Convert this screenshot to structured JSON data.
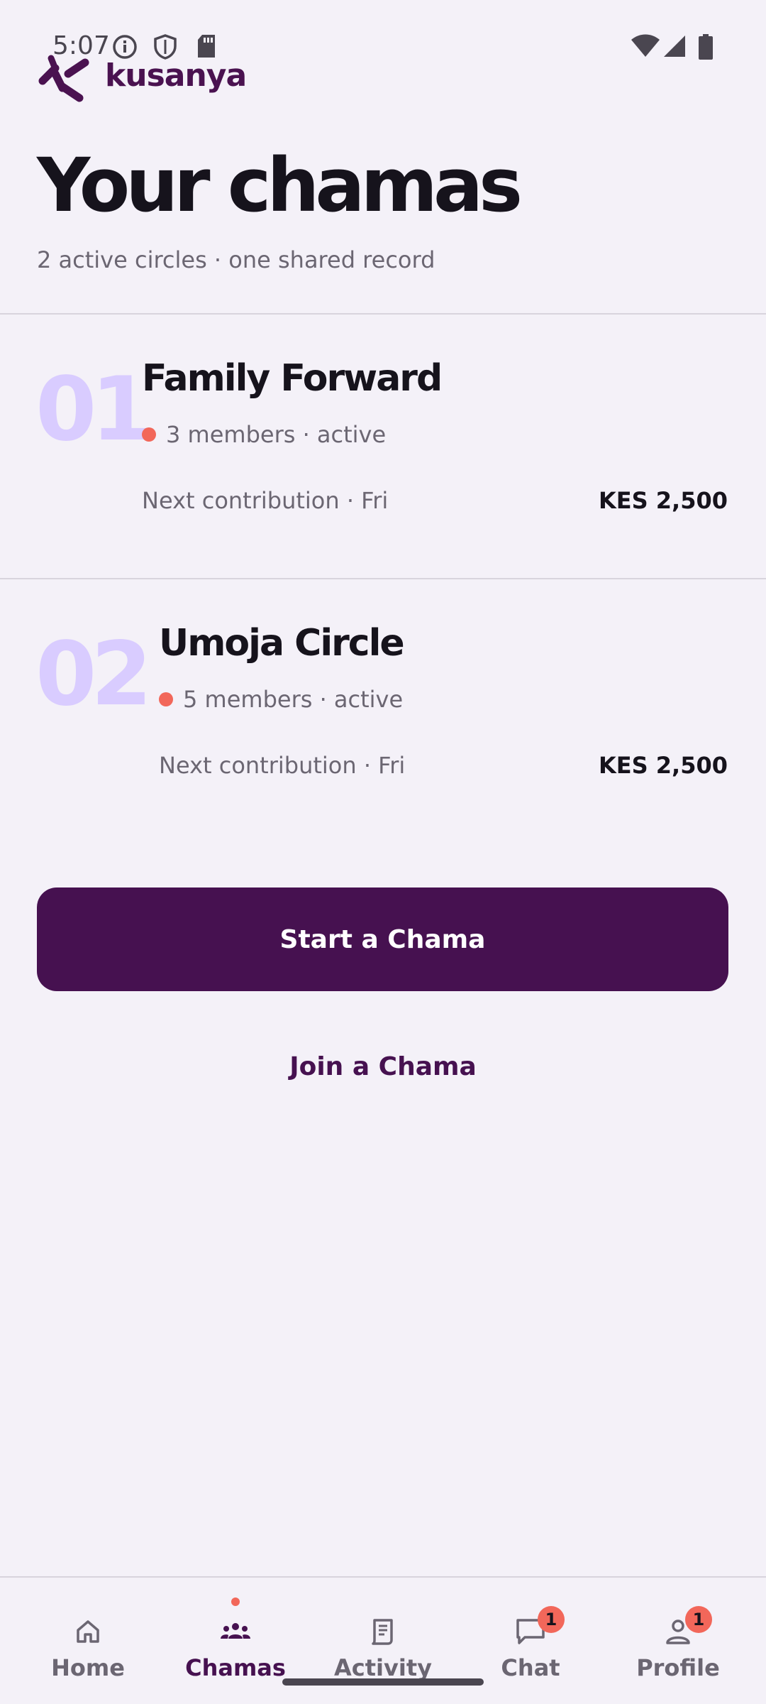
{
  "status_bar": {
    "time": "5:07"
  },
  "logo": {
    "text": "kusanya",
    "color": "#4a1250"
  },
  "header": {
    "title": "Your chamas",
    "subtitle": "2 active circles · one shared record"
  },
  "chamas": [
    {
      "number": "01",
      "name": "Family Forward",
      "meta": "3 members · active",
      "next": "Next contribution · Fri",
      "amount": "KES 2,500"
    },
    {
      "number": "02",
      "name": "Umoja Circle",
      "meta": "5 members · active",
      "next": "Next contribution · Fri",
      "amount": "KES 2,500"
    }
  ],
  "actions": {
    "start_label": "Start a Chama",
    "join_label": "Join a Chama"
  },
  "nav": {
    "items": [
      {
        "label": "Home",
        "icon": "home-icon"
      },
      {
        "label": "Chamas",
        "icon": "group-icon",
        "active": true
      },
      {
        "label": "Activity",
        "icon": "receipt-icon"
      },
      {
        "label": "Chat",
        "icon": "chat-icon",
        "badge": "1"
      },
      {
        "label": "Profile",
        "icon": "person-icon",
        "badge": "1"
      }
    ]
  },
  "colors": {
    "background": "#f4f1f8",
    "primary": "#461150",
    "accent_dot": "#f2675a",
    "number_tint": "#d9ccff"
  }
}
